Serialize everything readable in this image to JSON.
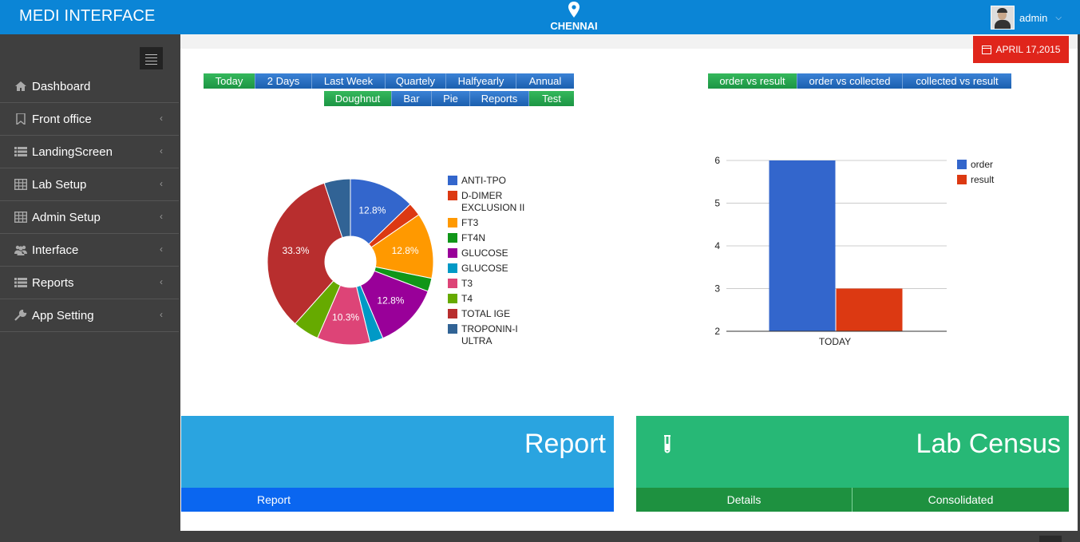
{
  "header": {
    "brand": "MEDI INTERFACE",
    "location": "CHENNAI",
    "user": "admin"
  },
  "sidebar": {
    "items": [
      {
        "label": "Dashboard",
        "icon": "home-icon"
      },
      {
        "label": "Front office",
        "icon": "bookmark-icon"
      },
      {
        "label": "LandingScreen",
        "icon": "list-icon"
      },
      {
        "label": "Lab Setup",
        "icon": "table-icon"
      },
      {
        "label": "Admin Setup",
        "icon": "table-icon"
      },
      {
        "label": "Interface",
        "icon": "users-icon"
      },
      {
        "label": "Reports",
        "icon": "list-icon"
      },
      {
        "label": "App Setting",
        "icon": "wrench-icon"
      }
    ]
  },
  "date_badge": "APRIL 17,2015",
  "period_buttons": [
    "Today",
    "2 Days",
    "Last Week",
    "Quartely",
    "Halfyearly",
    "Annual"
  ],
  "chart_type_buttons": [
    "Doughnut",
    "Bar",
    "Pie",
    "Reports",
    "Test"
  ],
  "compare_buttons": [
    "order vs result",
    "order vs collected",
    "collected vs result"
  ],
  "colors": {
    "accent": "#0b85d6",
    "green": "#22a84b",
    "red": "#e0251b",
    "report_tile": "#2aa4e0",
    "census_tile": "#27b876"
  },
  "chart_data": [
    {
      "type": "pie",
      "style": "doughnut",
      "categories": [
        "ANTI-TPO",
        "D-DIMER EXCLUSION II",
        "FT3",
        "FT4N",
        "GLUCOSE",
        "GLUCOSE",
        "T3",
        "T4",
        "TOTAL IGE",
        "TROPONIN-I ULTRA"
      ],
      "values": [
        12.8,
        2.6,
        12.8,
        2.6,
        12.8,
        2.6,
        10.3,
        5.1,
        33.3,
        5.1
      ],
      "colors": [
        "#3366cc",
        "#dc3912",
        "#ff9900",
        "#109618",
        "#990099",
        "#0099c6",
        "#dd4477",
        "#66aa00",
        "#b82e2e",
        "#316395"
      ],
      "data_labels": [
        "12.8%",
        "",
        "12.8%",
        "",
        "12.8%",
        "",
        "10.3%",
        "",
        "33.3%",
        ""
      ],
      "legend_position": "right"
    },
    {
      "type": "bar",
      "categories": [
        "TODAY"
      ],
      "series": [
        {
          "name": "order",
          "values": [
            6
          ],
          "color": "#3366cc"
        },
        {
          "name": "result",
          "values": [
            3
          ],
          "color": "#dc3912"
        }
      ],
      "ylim": [
        2,
        6
      ],
      "yticks": [
        "2",
        "3",
        "4",
        "5",
        "6"
      ],
      "grid": true,
      "legend_position": "top-right"
    }
  ],
  "tiles": {
    "report": {
      "title": "Report",
      "footer": "Report"
    },
    "census": {
      "title": "Lab Census",
      "icon": "test-tube-icon",
      "footers": [
        "Details",
        "Consolidated"
      ]
    }
  }
}
